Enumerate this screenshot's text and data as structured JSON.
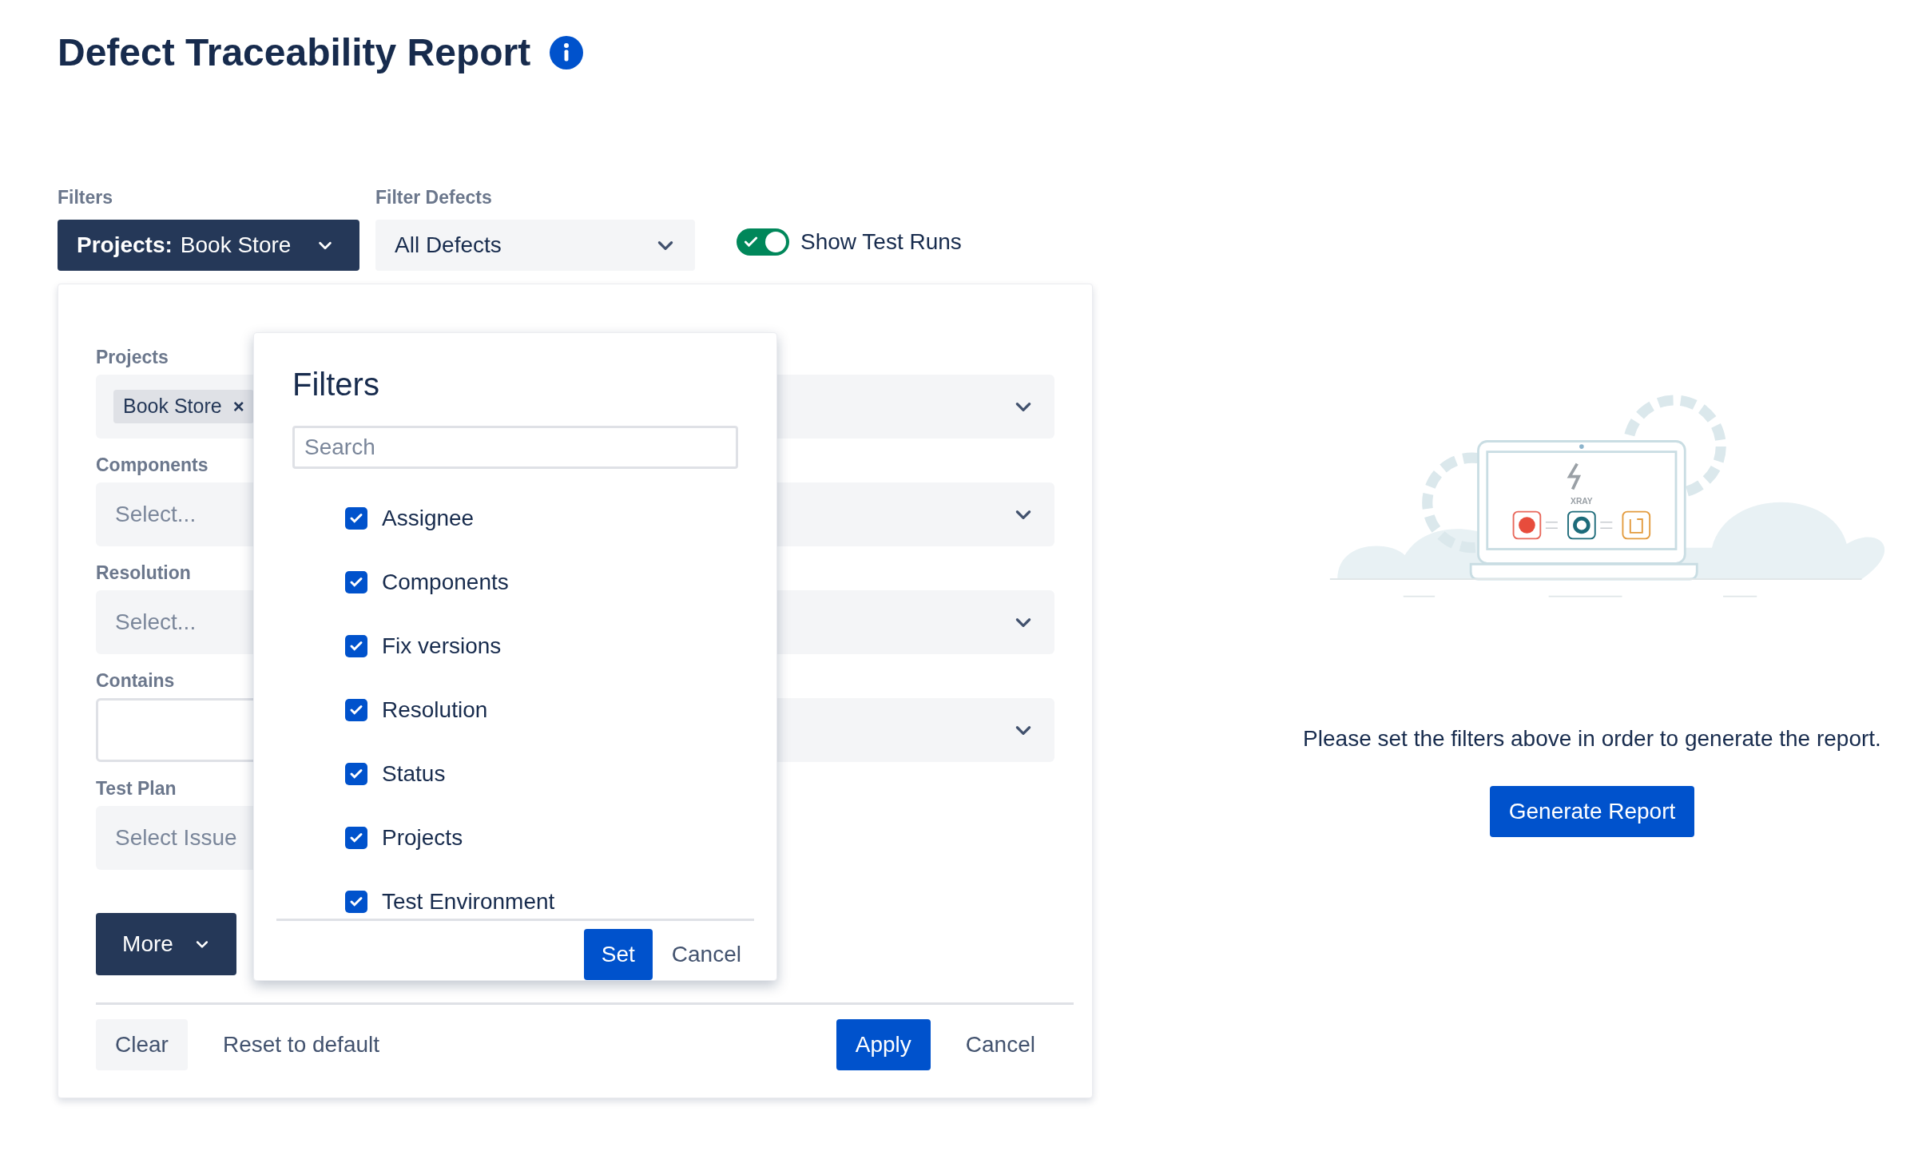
{
  "page": {
    "title": "Defect Traceability Report"
  },
  "toolbar": {
    "filters_label": "Filters",
    "filters_button": {
      "key": "Projects:",
      "value": "Book Store"
    },
    "filter_defects_label": "Filter Defects",
    "filter_defects_value": "All Defects",
    "show_test_runs": {
      "label": "Show Test Runs",
      "on": true
    }
  },
  "panel": {
    "fields": [
      {
        "kind": "tags",
        "label": "Projects",
        "tags": [
          {
            "label": "Book Store",
            "remove": "×"
          }
        ]
      },
      {
        "kind": "select",
        "label": "Components",
        "placeholder": "Select..."
      },
      {
        "kind": "select",
        "label": "Resolution",
        "placeholder": "Select..."
      },
      {
        "kind": "text",
        "label": "Contains"
      },
      {
        "kind": "issue",
        "label": "Test Plan",
        "placeholder": "Select Issue"
      }
    ],
    "more_button": "More",
    "clear_button": "Clear",
    "reset_link": "Reset to default",
    "apply_button": "Apply",
    "cancel_button": "Cancel"
  },
  "filters_popup": {
    "title": "Filters",
    "search_placeholder": "Search",
    "options": [
      {
        "label": "Assignee",
        "checked": true
      },
      {
        "label": "Components",
        "checked": true
      },
      {
        "label": "Fix versions",
        "checked": true
      },
      {
        "label": "Resolution",
        "checked": true
      },
      {
        "label": "Status",
        "checked": true
      },
      {
        "label": "Projects",
        "checked": true
      },
      {
        "label": "Test Environment",
        "checked": true
      }
    ],
    "set_button": "Set",
    "cancel_button": "Cancel"
  },
  "empty_state": {
    "logo_text": "XRAY",
    "message": "Please set the filters above in order to generate the report.",
    "button": "Generate Report"
  }
}
